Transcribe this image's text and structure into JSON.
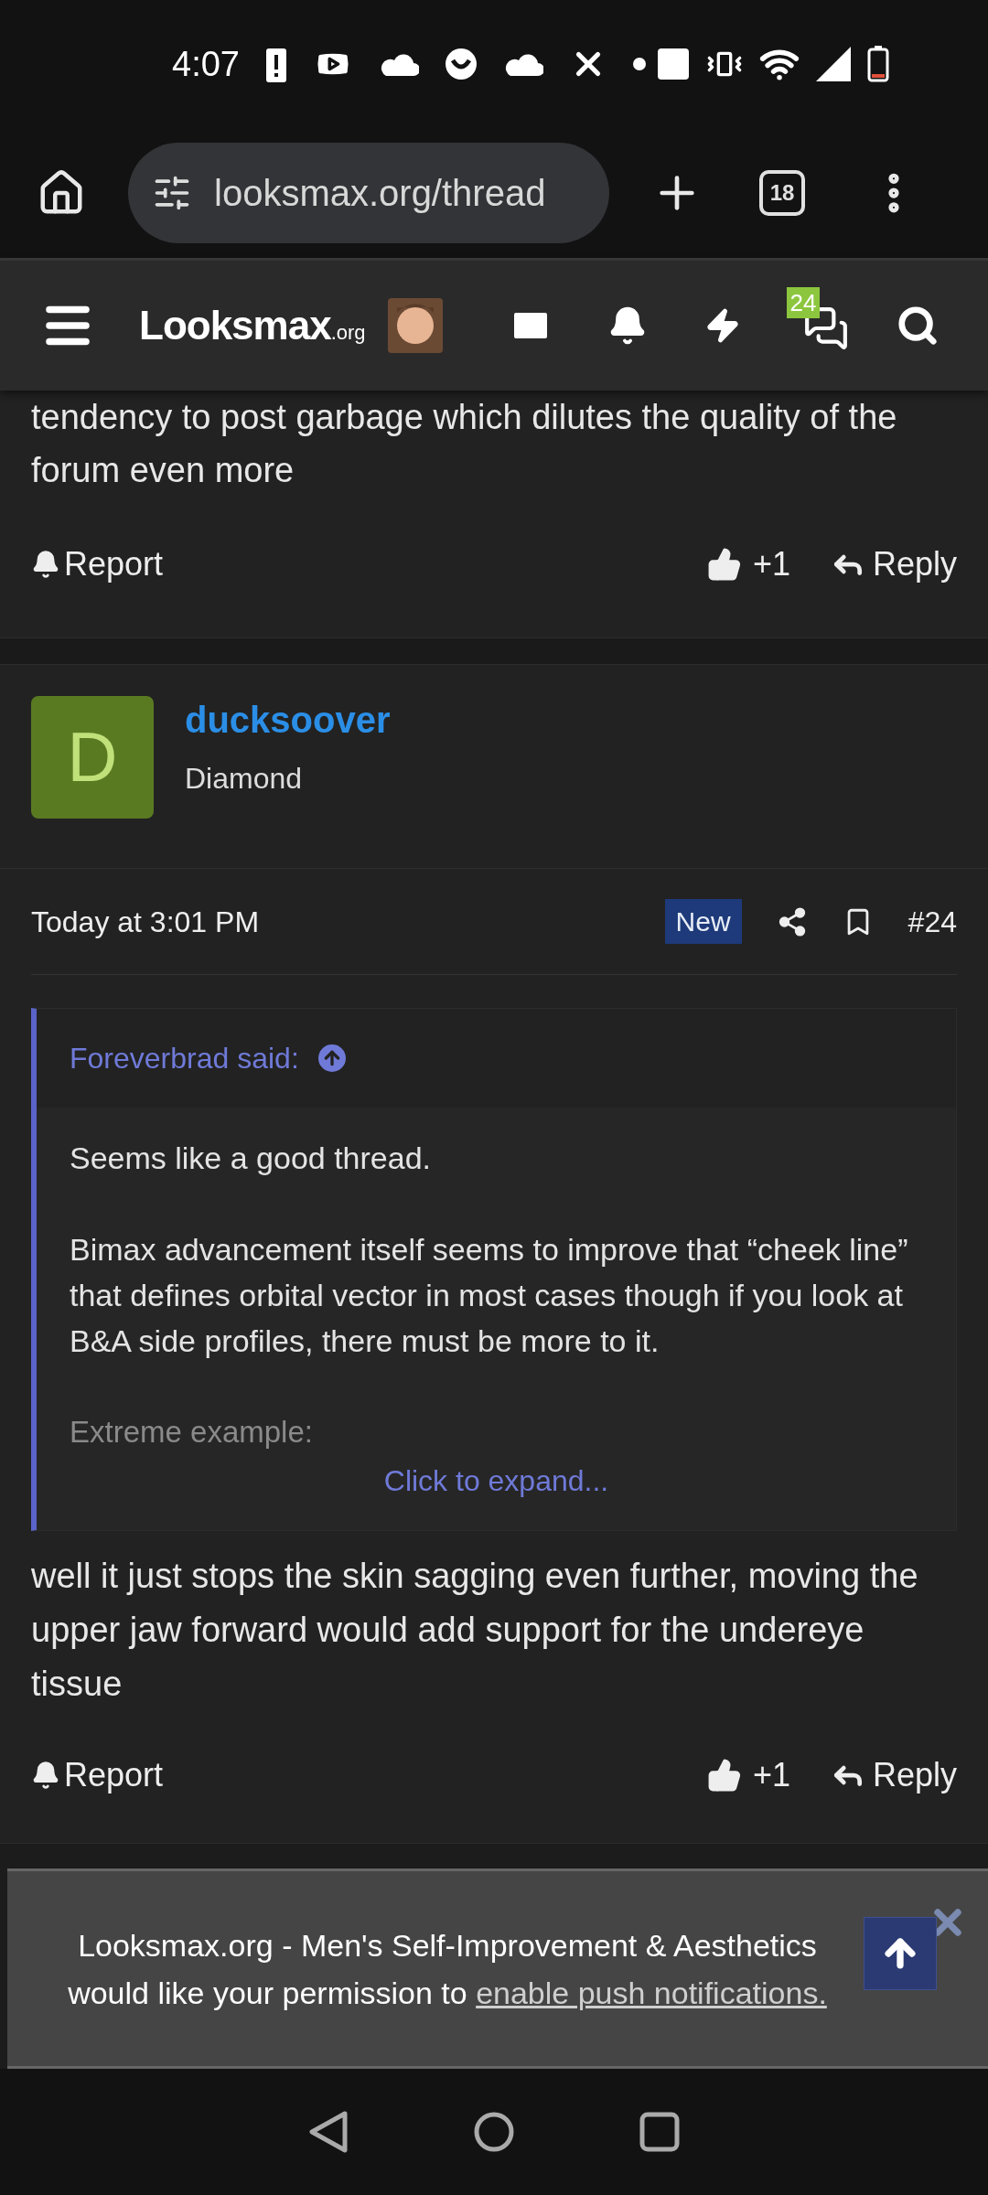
{
  "status_bar": {
    "time": "4:07"
  },
  "browser": {
    "url": "looksmax.org/thread",
    "tab_count": "18"
  },
  "forum_header": {
    "logo": "Looksmax",
    "logo_suffix": ".org",
    "conversations_badge": "24"
  },
  "posts": [
    {
      "kind": "tail",
      "body": "tendency to post garbage which dilutes the quality of the forum even more",
      "report": "Report",
      "likes": "+1",
      "reply": "Reply"
    },
    {
      "kind": "full",
      "avatar_letter": "D",
      "username": "ducksoover",
      "rank": "Diamond",
      "date": "Today at 3:01 PM",
      "badge": "New",
      "number": "#24",
      "quote": {
        "author": "Foreverbrad said:",
        "paragraphs": [
          "Seems like a good thread.",
          "Bimax advancement itself seems to improve that “cheek line” that defines orbital vector in most cases though if you look at B&A side profiles, there must be more to it."
        ],
        "faded": "Extreme example:",
        "expand": "Click to expand..."
      },
      "body": "well it just stops the skin sagging even further, moving the upper jaw forward would add support for the undereye tissue",
      "report": "Report",
      "likes": "+1",
      "reply": "Reply"
    }
  ],
  "banner": {
    "text": "Looksmax.org - Men's Self-Improvement & Aesthetics would like your permission to ",
    "link": "enable push notifications."
  }
}
